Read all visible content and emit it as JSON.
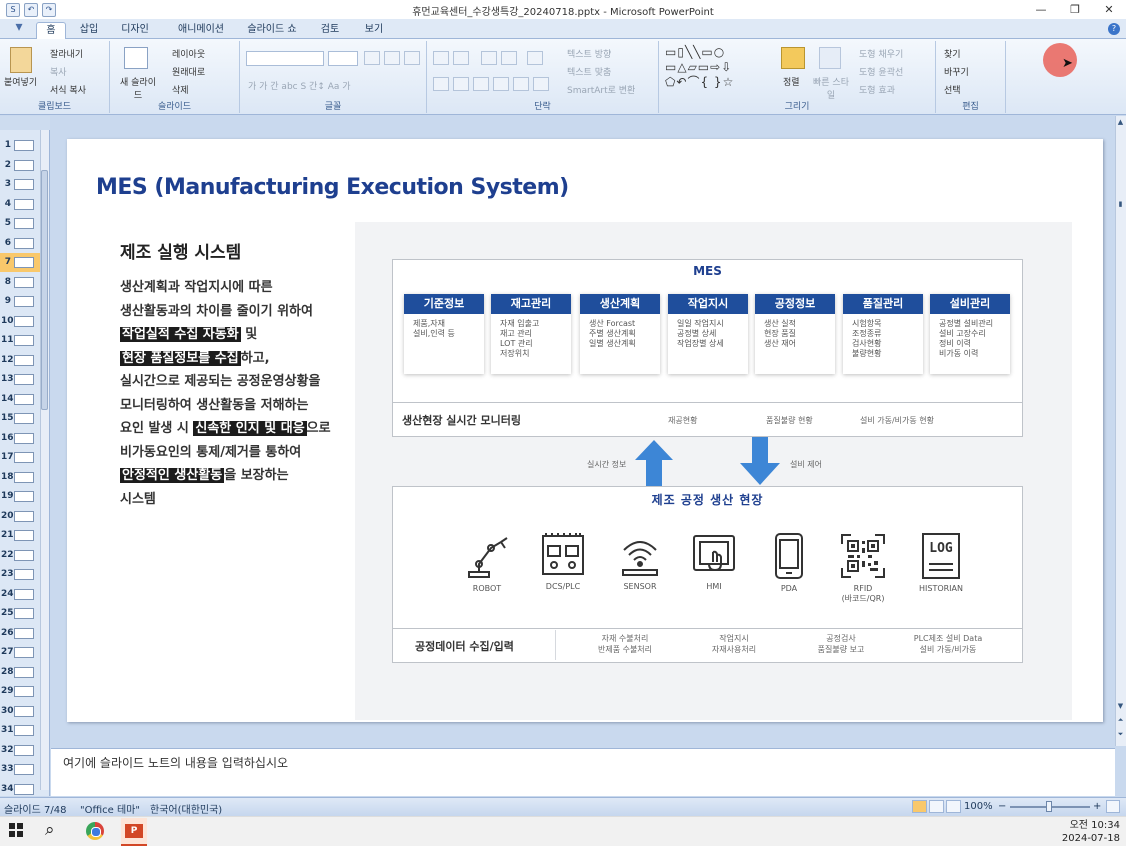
{
  "window": {
    "title": "휴먼교육센터_수강생특강_20240718.pptx - Microsoft PowerPoint",
    "controls": [
      "—",
      "❐",
      "✕"
    ]
  },
  "quick_access": [
    "S",
    "↶",
    "↷"
  ],
  "tabs": [
    "홈",
    "삽입",
    "디자인",
    "애니메이션",
    "슬라이드 쇼",
    "검토",
    "보기"
  ],
  "ribbon": {
    "clipboard": {
      "label": "클립보드",
      "paste": "붙여넣기",
      "cut": "잘라내기",
      "copy": "복사",
      "format_painter": "서식 복사"
    },
    "slides": {
      "label": "슬라이드",
      "new_slide": "새 슬라이드",
      "layout": "레이아웃",
      "reset": "원래대로",
      "delete": "삭제"
    },
    "font": {
      "label": "글꼴",
      "row2": "가  가  간  abc  S  간↕  Aa  가"
    },
    "paragraph": {
      "label": "단락",
      "text_direction": "텍스트 방향",
      "align_text": "텍스트 맞춤",
      "smartart": "SmartArt로 변환"
    },
    "drawing": {
      "label": "그리기",
      "shapes": "▭▯╲╲▭○\n▭△▱▭⇨⇩\n⬠↶⌒{ }☆",
      "arrange": "정렬",
      "quick_styles": "빠른 스타일",
      "shape_fill": "도형 채우기",
      "shape_outline": "도형 윤곽선",
      "shape_effects": "도형 효과"
    },
    "editing": {
      "label": "편집",
      "find": "찾기",
      "replace": "바꾸기",
      "select": "선택"
    }
  },
  "thumbnails": {
    "numbers": [
      "1",
      "2",
      "3",
      "4",
      "5",
      "6",
      "7",
      "8",
      "9",
      "10",
      "11",
      "12",
      "13",
      "14",
      "15",
      "16",
      "17",
      "18",
      "19",
      "20",
      "21",
      "22",
      "23",
      "24",
      "25",
      "26",
      "27",
      "28",
      "29",
      "30",
      "31",
      "32",
      "33",
      "34"
    ],
    "selected": "7"
  },
  "slide": {
    "title": "MES (Manufacturing Execution System)",
    "subtitle": "제조 실행 시스템",
    "body": {
      "l1": "생산계획과 작업지시에 따른",
      "l2": "생산활동과의 차이를 줄이기 위하여",
      "l3a": "작업실적 수집 자동화",
      "l3b": " 및",
      "l4a": "현장 품질정보를 수집",
      "l4b": "하고,",
      "l5": "실시간으로 제공되는 공정운영상황을",
      "l6": "모니터링하여 생산활동을 저해하는",
      "l7a": "요인 발생 시 ",
      "l7b": "신속한 인지 및 대응",
      "l7c": "으로",
      "l8": "비가동요인의 통제/제거를 통하여",
      "l9a": "안정적인 생산활동",
      "l9b": "을 보장하는",
      "l10": "시스템"
    },
    "diagram": {
      "mes_title": "MES",
      "modules": [
        {
          "name": "기준정보",
          "items": [
            "제품,자재",
            "설비,인력 등"
          ]
        },
        {
          "name": "재고관리",
          "items": [
            "자재 입출고",
            "재고 관리",
            "LOT 관리",
            "저장위치"
          ]
        },
        {
          "name": "생산계획",
          "items": [
            "생산 Forcast",
            "주별 생산계획",
            "일별 생산계획"
          ]
        },
        {
          "name": "작업지시",
          "items": [
            "일일 작업지시",
            "공정별 상세",
            "작업장별 상세"
          ]
        },
        {
          "name": "공정정보",
          "items": [
            "생산 실적",
            "현장 품질",
            "생산 재어"
          ]
        },
        {
          "name": "품질관리",
          "items": [
            "시험항목",
            "조정종류",
            "검사현황",
            "불량현황"
          ]
        },
        {
          "name": "설비관리",
          "items": [
            "공정별 설비관리",
            "설비 고장수리",
            "정비 이력",
            "비가동 이력"
          ]
        }
      ],
      "monitor_label": "생산현장 실시간 모니터링",
      "monitor_items": [
        "재공현황",
        "품질불량 현황",
        "설비 가동/비가동 현황"
      ],
      "arrow_up_label": "실시간 정보",
      "arrow_down_label": "설비 제어",
      "floor_title": "제조 공정 생산 현장",
      "devices": [
        {
          "icon": "robot-arm-icon",
          "label": "ROBOT"
        },
        {
          "icon": "plc-icon",
          "label": "DCS/PLC"
        },
        {
          "icon": "sensor-icon",
          "label": "SENSOR"
        },
        {
          "icon": "hmi-icon",
          "label": "HMI"
        },
        {
          "icon": "pda-icon",
          "label": "PDA"
        },
        {
          "icon": "qr-code-icon",
          "label": "RFID",
          "label2": "(바코드/QR)"
        },
        {
          "icon": "log-icon",
          "label": "HISTORIAN",
          "icon_text": "LOG"
        }
      ],
      "collect_label": "공정데이터 수집/입력",
      "collect_items": [
        {
          "l1": "자재 수불처리",
          "l2": "반제품 수불처리"
        },
        {
          "l1": "작업지시",
          "l2": "자재사용처리"
        },
        {
          "l1": "공정검사",
          "l2": "품질불량 보고"
        },
        {
          "l1": "PLC제조 설비 Data",
          "l2": "설비 가동/비가동"
        }
      ]
    }
  },
  "notes_placeholder": "여기에 슬라이드 노트의 내용을 입력하십시오",
  "status": {
    "slide_count": "슬라이드 7/48",
    "theme": "\"Office 테마\"",
    "language": "한국어(대한민국)",
    "zoom": "100%",
    "zoom_minus": "−",
    "zoom_plus": "+"
  },
  "taskbar": {
    "time": "오전 10:34",
    "date": "2024-07-18"
  },
  "colors": {
    "accent_blue": "#1f4e9c",
    "arrow_blue": "#3d86d6",
    "highlight_black": "#1c1c1c"
  }
}
